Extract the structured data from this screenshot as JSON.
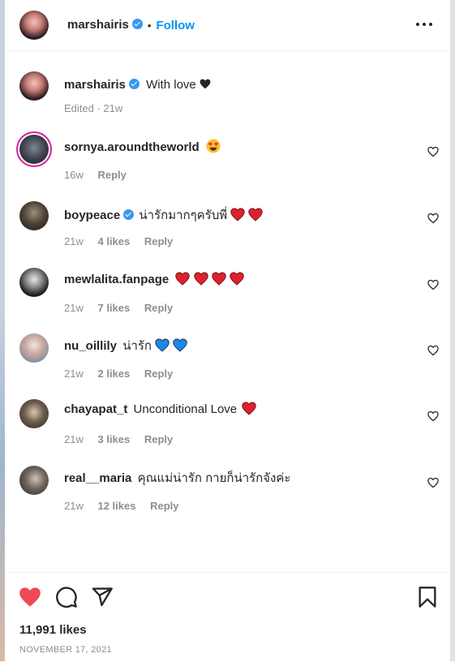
{
  "post": {
    "author": "marshairis",
    "follow_label": "Follow",
    "dot": "•",
    "caption": "With love",
    "caption_meta": "Edited · 21w"
  },
  "comments": [
    {
      "user": "sornya.aroundtheworld",
      "text": "",
      "time": "16w",
      "likes": "",
      "reply": "Reply",
      "verified": false
    },
    {
      "user": "boypeace",
      "text": "น่ารักมากๆครับพี่",
      "time": "21w",
      "likes": "4 likes",
      "reply": "Reply",
      "verified": true
    },
    {
      "user": "mewlalita.fanpage",
      "text": "",
      "time": "21w",
      "likes": "7 likes",
      "reply": "Reply",
      "verified": false
    },
    {
      "user": "nu_oillily",
      "text": "น่ารัก",
      "time": "21w",
      "likes": "2 likes",
      "reply": "Reply",
      "verified": false
    },
    {
      "user": "chayapat_t",
      "text": "Unconditional Love",
      "time": "21w",
      "likes": "3 likes",
      "reply": "Reply",
      "verified": false
    },
    {
      "user": "real__maria",
      "text": "คุณแม่น่ารัก กายก็น่ารักจังค่ะ",
      "time": "21w",
      "likes": "12 likes",
      "reply": "Reply",
      "verified": false
    }
  ],
  "footer": {
    "likes": "11,991 likes",
    "date": "NOVEMBER 17, 2021"
  },
  "colors": {
    "accent": "#0095f6",
    "like_red": "#ed4956",
    "muted": "#8e8e8e"
  }
}
